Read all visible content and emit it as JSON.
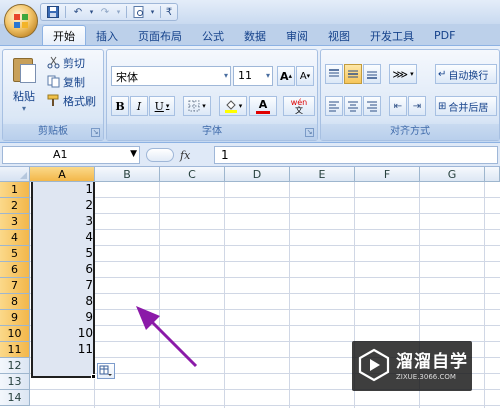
{
  "title_bar": {
    "icons": [
      "office-logo-icon",
      "save-icon",
      "undo-icon",
      "redo-icon",
      "print-preview-icon",
      "customize-icon"
    ]
  },
  "tabs": [
    {
      "label": "开始",
      "active": true
    },
    {
      "label": "插入"
    },
    {
      "label": "页面布局"
    },
    {
      "label": "公式"
    },
    {
      "label": "数据"
    },
    {
      "label": "审阅"
    },
    {
      "label": "视图"
    },
    {
      "label": "开发工具"
    },
    {
      "label": "PDF"
    }
  ],
  "ribbon": {
    "clipboard": {
      "paste_label": "粘贴",
      "cut_label": "剪切",
      "copy_label": "复制",
      "format_painter_label": "格式刷",
      "group_label": "剪贴板"
    },
    "font": {
      "font_name": "宋体",
      "font_size": "11",
      "grow_label": "A",
      "shrink_label": "A",
      "bold_label": "B",
      "italic_label": "I",
      "underline_label": "U",
      "font_color_label": "A",
      "phonetic_label": "wén",
      "group_label": "字体"
    },
    "alignment": {
      "wrap_text_label": "自动换行",
      "merge_center_label": "合并后居",
      "group_label": "对齐方式"
    }
  },
  "formula_bar": {
    "name_box": "A1",
    "fx_label": "fx",
    "formula": "1"
  },
  "grid": {
    "columns": [
      "A",
      "B",
      "C",
      "D",
      "E",
      "F",
      "G"
    ],
    "rows": [
      "1",
      "2",
      "3",
      "4",
      "5",
      "6",
      "7",
      "8",
      "9",
      "10",
      "11",
      "12",
      "13",
      "14"
    ],
    "column_a_values": [
      "1",
      "2",
      "3",
      "4",
      "5",
      "6",
      "7",
      "8",
      "9",
      "10",
      "11"
    ]
  },
  "annotation": {
    "arrow_color": "#8b1aa8"
  },
  "watermark": {
    "title": "溜溜自学",
    "subtitle": "ZIXUE.3066.COM"
  },
  "colors": {
    "selected_header": "#f3b74a",
    "selection_fill": "#dfe6f2",
    "ribbon_bg": "#d5e3f5"
  }
}
